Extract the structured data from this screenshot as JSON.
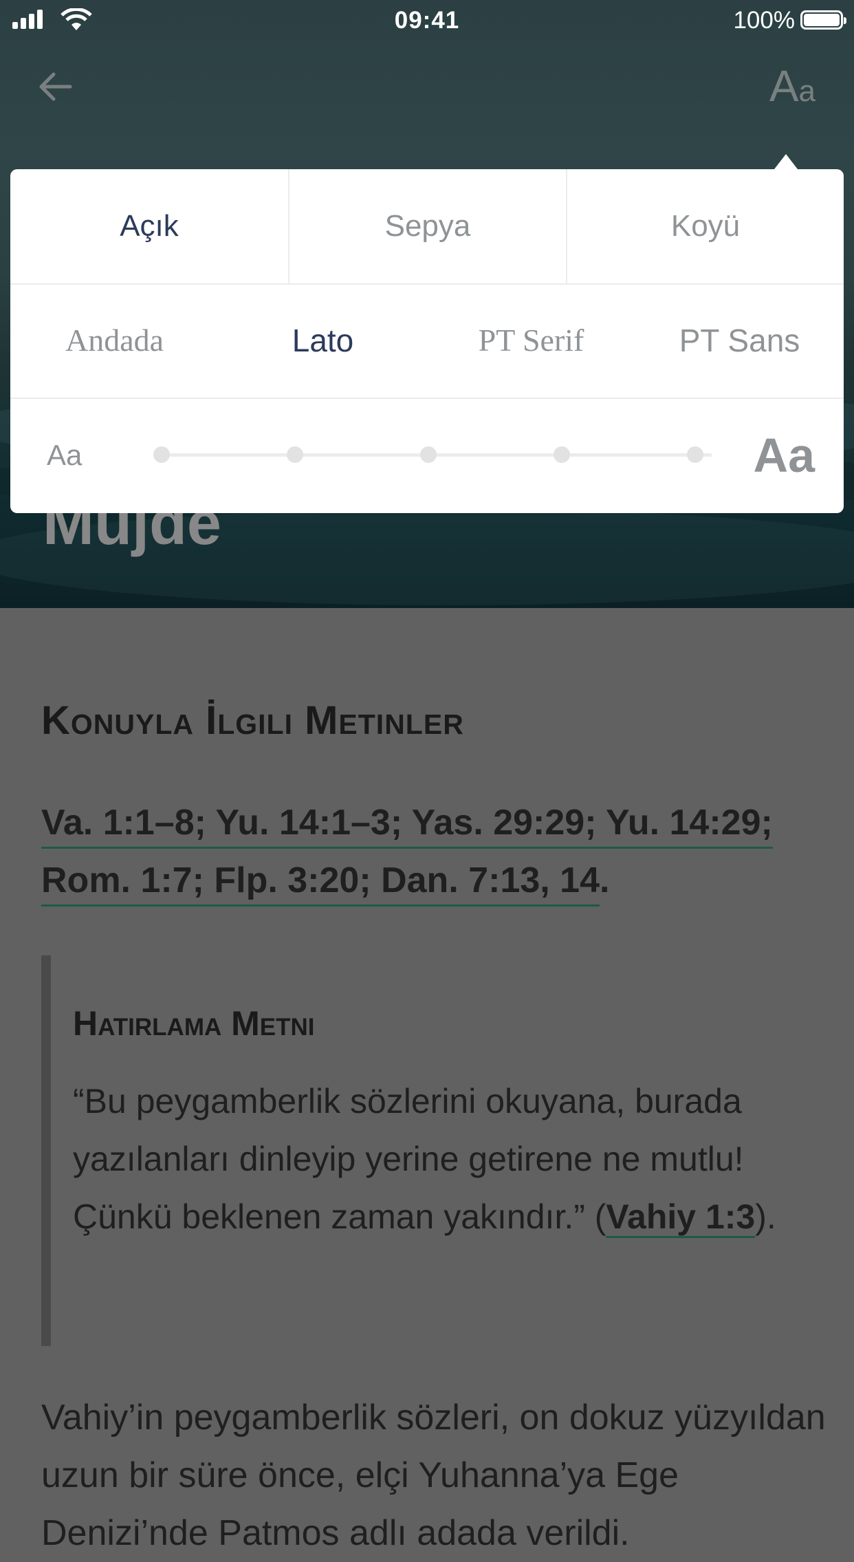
{
  "status": {
    "time": "09:41",
    "battery": "100%"
  },
  "header": {
    "aa_big": "A",
    "aa_small": "a"
  },
  "hero": {
    "title": "Müjde"
  },
  "settings": {
    "themes": [
      "Açık",
      "Sepya",
      "Koyü"
    ],
    "fonts": [
      "Andada",
      "Lato",
      "PT Serif",
      "PT Sans"
    ],
    "size_small_label": "Aa",
    "size_large_label": "Aa"
  },
  "content": {
    "section_title": "Konuyla İlgili Metinler",
    "refs_line1": "Va. 1:1–8; Yu. 14:1–3; Yas. 29:29; Yu. 14:29;",
    "refs_line2": "Rom. 1:7; Flp. 3:20; Dan. 7:13, 14",
    "refs_end": ".",
    "memory_title": "Hatırlama Metni",
    "memory_text": "“Bu peygamberlik sözlerini okuyana, burada yazılanları dinleyip yerine getirene ne mutlu! Çünkü beklenen zaman yakındır.” (",
    "memory_ref": "Vahiy 1:3",
    "memory_end": ").",
    "paragraph": "Vahiy’in peygamberlik sözleri, on dokuz yüzyıldan uzun bir süre önce, elçi Yuhanna’ya Ege Denizi’nde Patmos adlı adada verildi."
  }
}
